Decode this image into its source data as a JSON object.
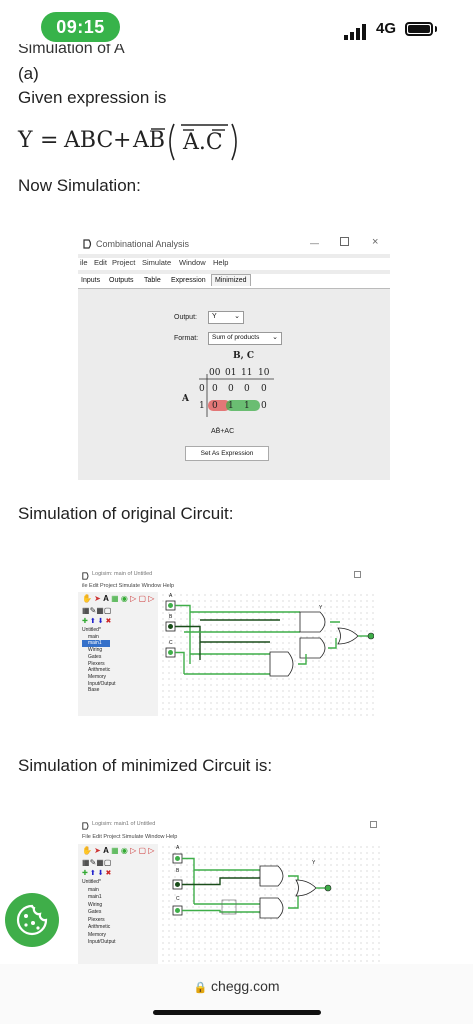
{
  "status": {
    "time": "09:15",
    "network": "4G"
  },
  "cut_heading": "Simulation of A",
  "part_label": "(a)",
  "given_label": "Given expression is",
  "equation": {
    "lhs": "Y",
    "term1": "ABC",
    "term2": "AB",
    "term3": "A.C"
  },
  "now_sim": "Now Simulation:",
  "combinational": {
    "title": "Combinational Analysis",
    "menu": [
      "ile",
      "Edit",
      "Project",
      "Simulate",
      "Window",
      "Help"
    ],
    "tabs": [
      "Inputs",
      "Outputs",
      "Table",
      "Expression",
      "Minimized"
    ],
    "output_label": "Output:",
    "output_value": "Y",
    "format_label": "Format:",
    "format_value": "Sum of products",
    "kmap": {
      "col_var": "B, C",
      "row_var": "A",
      "col_headers": [
        "00",
        "01",
        "11",
        "10"
      ],
      "row_headers": [
        "0",
        "1"
      ],
      "rows": [
        [
          "0",
          "0",
          "0",
          "0"
        ],
        [
          "0",
          "1",
          "1",
          "0"
        ]
      ]
    },
    "expression": "AB̄+AC",
    "button": "Set As Expression"
  },
  "sim_original_label": "Simulation of  original Circuit:",
  "sim_min_label": "Simulation of minimized Circuit is:",
  "logisim1": {
    "title": "Logisim: main of Untitled",
    "menu": "ile  Edit  Project  Simulate  Window  Help",
    "tree": [
      "Untitled*",
      "main",
      "main1",
      "Wiring",
      "Gates",
      "Plexers",
      "Arithmetic",
      "Memory",
      "Input/Output",
      "Base"
    ],
    "pins": [
      "A",
      "B",
      "C"
    ],
    "output": "Y"
  },
  "logisim2": {
    "title": "Logisim: main1 of Untitled",
    "menu": "File  Edit  Project  Simulate  Window  Help",
    "tree": [
      "Untitled*",
      "main",
      "main1",
      "Wiring",
      "Gates",
      "Plexers",
      "Arithmetic",
      "Memory",
      "Input/Output"
    ],
    "pins": [
      "A",
      "B",
      "C"
    ],
    "output": "Y"
  },
  "url": "chegg.com",
  "colors": {
    "green": "#3fae49",
    "wire": "#2e8b22",
    "dark_wire": "#1a4d1a",
    "red": "#e05050"
  }
}
